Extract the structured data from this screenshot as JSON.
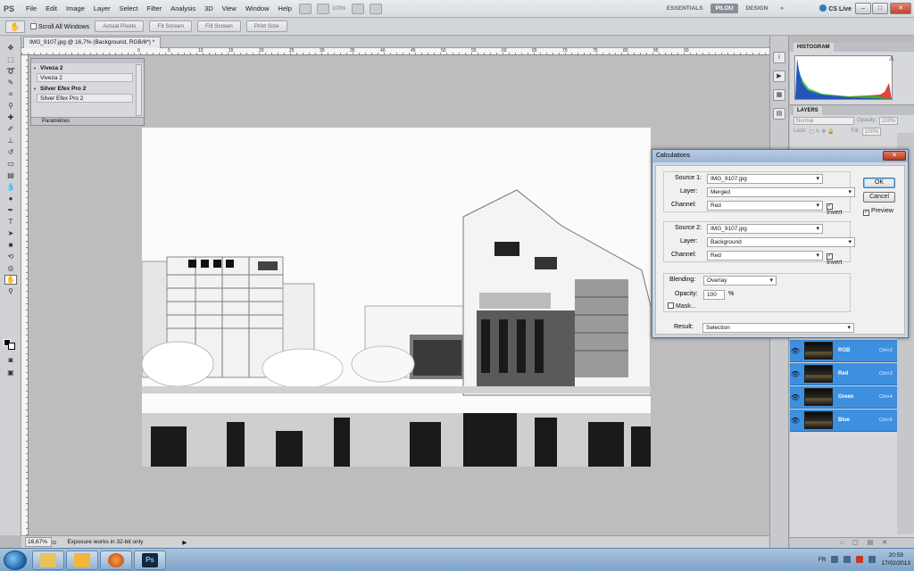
{
  "app": {
    "logo": "PS",
    "menus": [
      "File",
      "Edit",
      "Image",
      "Layer",
      "Select",
      "Filter",
      "Analysis",
      "3D",
      "View",
      "Window",
      "Help"
    ],
    "zoom_dropdown": "100%",
    "workspaces": [
      "ESSENTIALS",
      "PILOU",
      "DESIGN"
    ],
    "workspace_more": "»",
    "cs_live": "CS Live"
  },
  "options_bar": {
    "scroll_all_windows": "Scroll All Windows",
    "buttons": [
      "Actual Pixels",
      "Fit Screen",
      "Fill Screen",
      "Print Size"
    ]
  },
  "document": {
    "tab_title": "IMG_9107.jpg @ 16,7% (Background, RGB/8*) *",
    "ruler_marks": [
      "0",
      "5",
      "10",
      "15",
      "20",
      "25",
      "30",
      "35",
      "40",
      "45",
      "50",
      "55",
      "60",
      "65",
      "70",
      "75",
      "80",
      "85",
      "90"
    ]
  },
  "plugins_panel": {
    "items": [
      {
        "title": "Viveza 2",
        "field": "Viveza 2"
      },
      {
        "title": "Silver Efex Pro 2",
        "field": "Silver Efex Pro 2"
      }
    ],
    "footer": "Paramètres"
  },
  "histogram": {
    "tab": "HISTOGRAM",
    "warning": "⚠"
  },
  "layers": {
    "tab": "LAYERS",
    "blend_mode": "Normal",
    "opacity_label": "Opacity:",
    "opacity_value": "100%",
    "lock_label": "Lock:",
    "fill_label": "Fill:",
    "fill_value": "100%",
    "channels": [
      {
        "name": "RGB",
        "shortcut": "Ctrl+2"
      },
      {
        "name": "Red",
        "shortcut": "Ctrl+3"
      },
      {
        "name": "Green",
        "shortcut": "Ctrl+4"
      },
      {
        "name": "Blue",
        "shortcut": "Ctrl+5"
      }
    ]
  },
  "dialog": {
    "title": "Calculations",
    "source1": {
      "label": "Source 1:",
      "file": "IMG_9107.jpg",
      "layer_label": "Layer:",
      "layer": "Merged",
      "channel_label": "Channel:",
      "channel": "Red",
      "invert_label": "Invert",
      "invert_checked": "✓"
    },
    "source2": {
      "label": "Source 2:",
      "file": "IMG_9107.jpg",
      "layer_label": "Layer:",
      "layer": "Background",
      "channel_label": "Channel:",
      "channel": "Red",
      "invert_label": "Invert",
      "invert_checked": "✓"
    },
    "blending_label": "Blending:",
    "blending": "Overlay",
    "opacity_label": "Opacity:",
    "opacity": "100",
    "opacity_unit": "%",
    "mask_label": "Mask...",
    "result_label": "Result:",
    "result": "Selection",
    "ok": "OK",
    "cancel": "Cancel",
    "preview_label": "Preview",
    "preview_checked": "✓"
  },
  "status_bar": {
    "zoom": "16,67%",
    "text": "Exposure works in 32-bit only"
  },
  "taskbar": {
    "language": "FR",
    "time": "20:59",
    "date": "17/02/2013",
    "apps": [
      "explorer",
      "document",
      "firefox",
      "photoshop"
    ],
    "ps_label": "Ps"
  },
  "colors": {
    "selection_blue": "#3d8fe0",
    "dialog_frame": "#cdd7e4"
  }
}
